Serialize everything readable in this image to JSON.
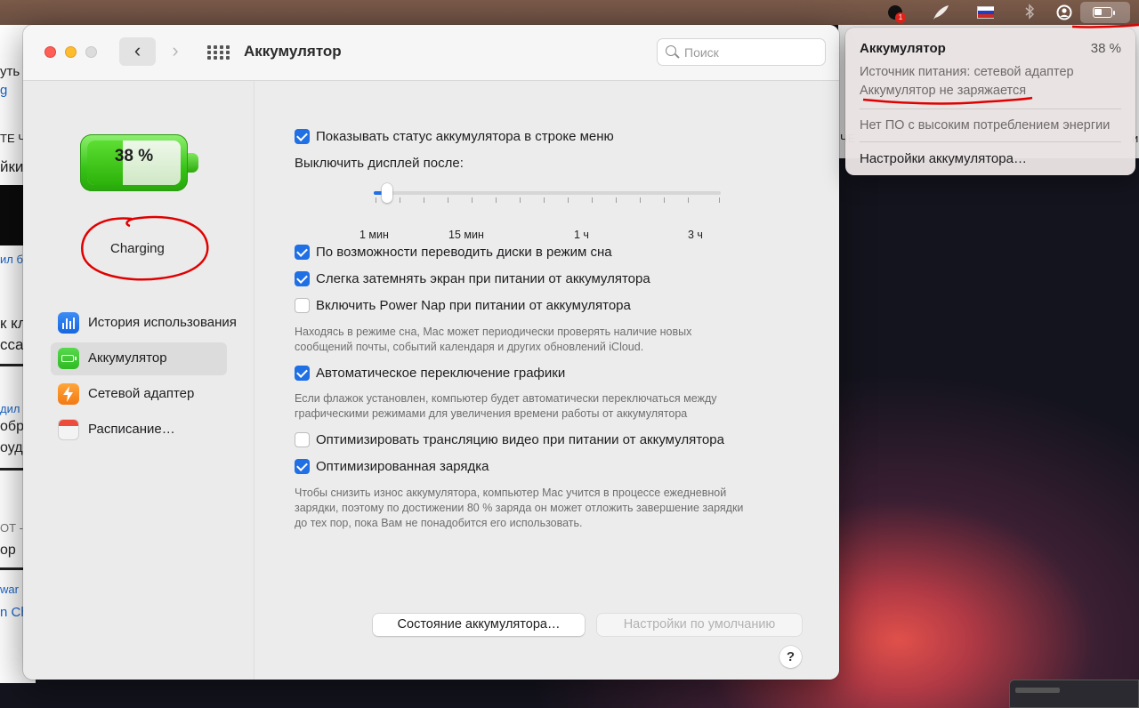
{
  "menubar": {
    "badge_count": "1",
    "icons": [
      "app-badge-icon",
      "feather-icon",
      "russian-flag-icon",
      "bluetooth-icon",
      "user-account-icon",
      "battery-status-icon"
    ]
  },
  "background_window": {
    "fragments": [
      "уть",
      "g",
      "ТЕ Ч",
      "йки",
      "ил б",
      "к кл",
      "сса",
      "дил",
      "обр",
      "оуд",
      "ОТ -",
      "ор",
      "war",
      "n Ch"
    ]
  },
  "background_window_right": {
    "fragments": [
      "ЧЕ",
      "и"
    ]
  },
  "window": {
    "title": "Аккумулятор",
    "search_placeholder": "Поиск"
  },
  "sidebar": {
    "battery_percent": "38 %",
    "battery_level": 0.38,
    "annotation_text": "Charging",
    "items": [
      {
        "label": "История использования",
        "icon": "bar-chart-icon",
        "active": false
      },
      {
        "label": "Аккумулятор",
        "icon": "battery-icon",
        "active": true
      },
      {
        "label": "Сетевой адаптер",
        "icon": "lightning-bolt-icon",
        "active": false
      },
      {
        "label": "Расписание…",
        "icon": "calendar-icon",
        "active": false
      }
    ]
  },
  "settings": {
    "show_status": {
      "label": "Показывать статус аккумулятора в строке меню",
      "checked": true
    },
    "display_off_label": "Выключить дисплей после:",
    "slider": {
      "value": "1 мин",
      "tick_labels": [
        "1 мин",
        "15 мин",
        "1 ч",
        "3 ч"
      ]
    },
    "disk_sleep": {
      "label": "По возможности переводить диски в режим сна",
      "checked": true
    },
    "dim_screen": {
      "label": "Слегка затемнять экран при питании от аккумулятора",
      "checked": true
    },
    "power_nap": {
      "label": "Включить Power Nap при питании от аккумулятора",
      "checked": false
    },
    "power_nap_desc_1": "Находясь в режиме сна, Mac может периодически проверять наличие новых",
    "power_nap_desc_2": "сообщений почты, событий календаря и других обновлений iCloud.",
    "auto_graphics": {
      "label": "Автоматическое переключение графики",
      "checked": true
    },
    "auto_graphics_desc_1": "Если флажок установлен, компьютер будет автоматически переключаться между",
    "auto_graphics_desc_2": "графическими режимами для увеличения времени работы от аккумулятора",
    "optimize_video": {
      "label": "Оптимизировать трансляцию видео при питании от аккумулятора",
      "checked": false
    },
    "optimized_charging": {
      "label": "Оптимизированная зарядка",
      "checked": true
    },
    "optimized_charging_desc_1": "Чтобы снизить износ аккумулятора, компьютер Mac учится в процессе ежедневной",
    "optimized_charging_desc_2": "зарядки, поэтому по достижении 80 % заряда он может отложить завершение зарядки",
    "optimized_charging_desc_3": "до тех пор, пока Вам не понадобится его использовать.",
    "battery_health_button": "Состояние аккумулятора…",
    "defaults_button": "Настройки по умолчанию",
    "help_label": "?"
  },
  "battery_menu": {
    "title": "Аккумулятор",
    "percent": "38 %",
    "power_source": "Источник питания: сетевой адаптер",
    "charge_status": "Аккумулятор не заряжается",
    "energy_apps": "Нет ПО с высоким потреблением энергии",
    "settings_link": "Настройки аккумулятора…"
  },
  "colors": {
    "accent": "#1f6fe5",
    "annotation_red": "#e00000",
    "battery_green": "#35c315"
  }
}
